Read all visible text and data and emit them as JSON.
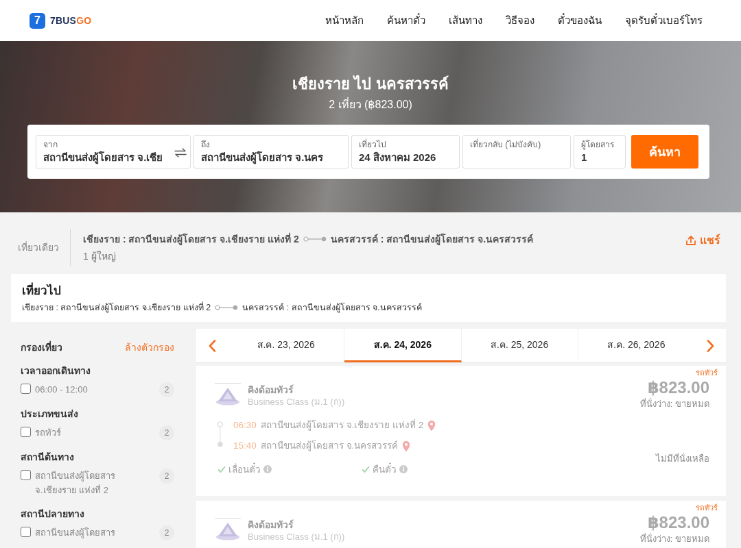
{
  "header": {
    "logo": {
      "mark": "7",
      "name": "7BUS",
      "accent": "GO"
    },
    "nav": [
      "หน้าหลัก",
      "ค้นหาตั๋ว",
      "เส้นทาง",
      "วิธีจอง",
      "ตั๋วของฉัน",
      "จุดรับตั๋วเบอร์โทร"
    ]
  },
  "hero": {
    "title": "เชียงราย ไป นครสวรรค์",
    "subtitle": "2 เที่ยว (฿823.00)"
  },
  "search": {
    "fields": [
      {
        "kind": "station",
        "label": "จาก",
        "value": "สถานีขนส่งผู้โดยสาร จ.เชีย",
        "swappable": true
      },
      {
        "kind": "station",
        "label": "ถึง",
        "value": "สถานีขนส่งผู้โดยสาร จ.นคร",
        "swappable": false
      },
      {
        "kind": "date",
        "label": "เที่ยวไป",
        "value": "24 สิงหาคม 2026",
        "swappable": false
      },
      {
        "kind": "date",
        "label": "เที่ยวกลับ (ไม่บังคับ)",
        "swappable": false
      },
      {
        "kind": "count",
        "label": "ผู้โดยสาร",
        "value": "1",
        "swappable": false
      }
    ],
    "button": "ค้นหา"
  },
  "summary": {
    "trip_type": "เที่ยวเดียว",
    "origin": "เชียงราย : สถานีขนส่งผู้โดยสาร จ.เชียงราย แห่งที่ 2",
    "destination": "นครสวรรค์ : สถานีขนส่งผู้โดยสาร จ.นครสวรรค์",
    "passengers": "1 ผู้ใหญ่",
    "share": "แชร์"
  },
  "outbound": {
    "title": "เที่ยวไป",
    "origin": "เชียงราย : สถานีขนส่งผู้โดยสาร จ.เชียงราย แห่งที่ 2",
    "destination": "นครสวรรค์ : สถานีขนส่งผู้โดยสาร จ.นครสวรรค์"
  },
  "filters": {
    "title": "กรองเที่ยว",
    "clear": "ล้างตัวกรอง",
    "groups": [
      {
        "title": "เวลาออกเดินทาง",
        "options": [
          {
            "label": "06:00 - 12:00",
            "count": "2",
            "checked": false
          }
        ]
      },
      {
        "title": "ประเภทขนส่ง",
        "options": [
          {
            "label": "รถทัวร์",
            "count": "2",
            "checked": false
          }
        ]
      },
      {
        "title": "สถานีต้นทาง",
        "options": [
          {
            "label": "สถานีขนส่งผู้โดยสาร จ.เชียงราย แห่งที่ 2",
            "count": "2",
            "checked": false
          }
        ]
      },
      {
        "title": "สถานีปลายทาง",
        "options": [
          {
            "label": "สถานีขนส่งผู้โดยสาร",
            "count": "2",
            "checked": false
          }
        ]
      }
    ]
  },
  "dates": [
    {
      "label": "ส.ค. 23, 2026",
      "selected": false
    },
    {
      "label": "ส.ค. 24, 2026",
      "selected": true
    },
    {
      "label": "ส.ค. 25, 2026",
      "selected": false
    },
    {
      "label": "ส.ค. 26, 2026",
      "selected": false
    }
  ],
  "trips": [
    {
      "vehicle": "รถทัวร์",
      "operator": "คิงด้อมทัวร์",
      "class": "Business Class (ม.1 (ก))",
      "price": "฿823.00",
      "seats": "ที่นั่งว่าง: ขายหมด",
      "sold_out": true,
      "departure": {
        "time": "06:30",
        "station": "สถานีขนส่งผู้โดยสาร จ.เชียงราย แห่งที่ 2"
      },
      "arrival": {
        "time": "15:40",
        "station": "สถานีขนส่งผู้โดยสาร จ.นครสวรรค์"
      },
      "features": [
        {
          "label": "เลื่อนตั๋ว",
          "available": true
        },
        {
          "label": "คืนตั๋ว",
          "available": true
        }
      ],
      "availability": "ไม่มีที่นั่งเหลือ"
    },
    {
      "vehicle": "รถทัวร์",
      "operator": "คิงด้อมทัวร์",
      "class": "Business Class (ม.1 (ก))",
      "price": "฿823.00",
      "seats": "ที่นั่งว่าง: ขายหมด",
      "sold_out": true
    }
  ]
}
